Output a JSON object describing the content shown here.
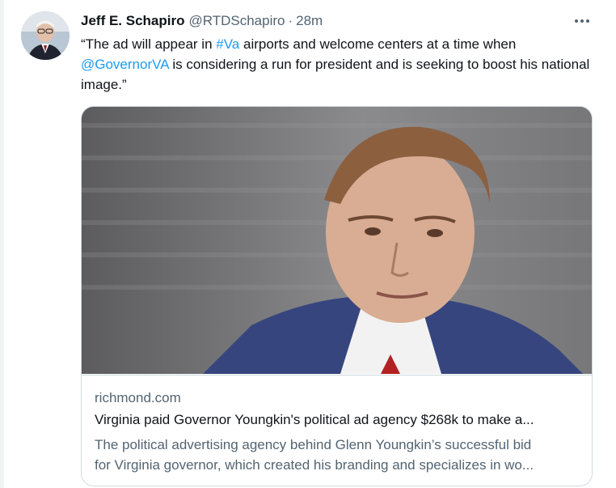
{
  "tweet": {
    "author_name": "Jeff E. Schapiro",
    "author_handle": "@RTDSchapiro",
    "separator": "·",
    "time": "28m",
    "more_icon": "more-horizontal-icon",
    "text": {
      "part1": "“The ad will appear in ",
      "hashtag": "#Va",
      "part2": " airports and welcome centers at a time when ",
      "mention": "@GovernorVA",
      "part3": " is considering a run for president and is seeking to boost his national image.”"
    },
    "card": {
      "domain": "richmond.com",
      "headline": "Virginia paid Governor Youngkin's political ad agency $268k to make a...",
      "description_line1": "The political advertising agency behind Glenn Youngkin’s successful bid",
      "description_line2": "for Virginia governor, which created his branding and specializes in wo..."
    }
  },
  "colors": {
    "link": "#1d9bf0",
    "secondary_text": "#536471",
    "border": "#cfd9de"
  }
}
